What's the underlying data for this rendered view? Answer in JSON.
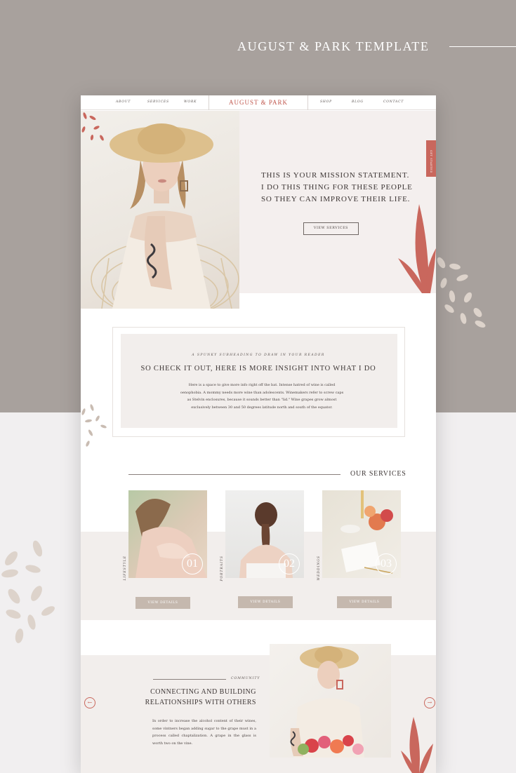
{
  "banner": {
    "title": "AUGUST & PARK TEMPLATE"
  },
  "colors": {
    "accent": "#c9675d",
    "banner_bg": "#a8a19d",
    "panel_bg": "#f2eeec",
    "button_fill": "#c5b8ae"
  },
  "nav": {
    "left": [
      "ABOUT",
      "SERVICES",
      "WORK"
    ],
    "logo": "AUGUST & PARK",
    "right": [
      "SHOP",
      "BLOG",
      "CONTACT"
    ]
  },
  "hero": {
    "mission_lines": [
      "THIS IS YOUR MISSION STATEMENT.",
      "I DO THIS THING FOR THESE PEOPLE",
      "SO THEY CAN IMPROVE THEIR LIFE."
    ],
    "button": "VIEW SERVICES",
    "side_tab": "GET STARTED"
  },
  "insight": {
    "kicker": "A SPUNKY SUBHEADING TO DRAW IN YOUR READER",
    "title": "SO CHECK IT OUT, HERE IS MORE INSIGHT INTO WHAT I DO",
    "body": "Here is a space to give more info right off the bat. Intense hatred of wine is called oenophobia. A mommy needs more wine than adolescents. Winemakers refer to screw caps as Stelvin enclosures, because it sounds better than \"lid.\" Wine grapes grow almost exclusively between 30 and 50 degrees latitude north and south of the equator."
  },
  "services": {
    "heading": "OUR SERVICES",
    "items": [
      {
        "label": "LIFESTYLE",
        "number": "01",
        "button": "VIEW DETAILS"
      },
      {
        "label": "PORTRAITS",
        "number": "02",
        "button": "VIEW DETAILS"
      },
      {
        "label": "WEDDINGS",
        "number": "03",
        "button": "VIEW DETAILS"
      }
    ]
  },
  "community": {
    "kicker": "COMMUNITY",
    "title": "CONNECTING AND BUILDING RELATIONSHIPS WITH OTHERS",
    "body": "In order to increase the alcohol content of their wines, some vintners began adding sugar to the grape must in a process called chaptalization. A grape in the glass is worth two on the vine.",
    "prev_icon": "arrow-left-icon",
    "next_icon": "arrow-right-icon"
  }
}
